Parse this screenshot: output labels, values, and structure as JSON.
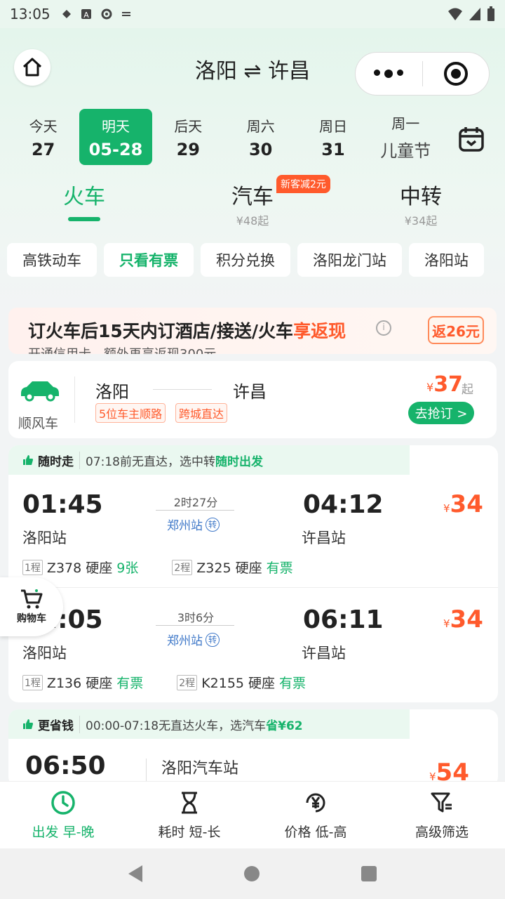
{
  "status_bar": {
    "time": "13:05"
  },
  "header": {
    "title": "洛阳 ⇌ 许昌"
  },
  "dates": [
    {
      "label": "今天",
      "value": "27"
    },
    {
      "label": "明天",
      "value": "05-28"
    },
    {
      "label": "后天",
      "value": "29"
    },
    {
      "label": "周六",
      "value": "30"
    },
    {
      "label": "周日",
      "value": "31"
    },
    {
      "label": "周一",
      "value": "儿童节"
    }
  ],
  "modes": {
    "train": {
      "label": "火车"
    },
    "bus": {
      "label": "汽车",
      "sub": "¥48起",
      "badge": "新客减2元"
    },
    "transfer": {
      "label": "中转",
      "sub": "¥34起"
    }
  },
  "filters": [
    "高铁动车",
    "只看有票",
    "积分兑换",
    "洛阳龙门站",
    "洛阳站"
  ],
  "promo": {
    "title_prefix": "订火车后15天内订酒店/接送/火车",
    "title_highlight": "享返现",
    "info": "i",
    "rebate": "返26元",
    "sub": "开通信用卡，额外再享返现300元"
  },
  "ride": {
    "label": "顺风车",
    "from": "洛阳",
    "to": "许昌",
    "tag1": "5位车主顺路",
    "tag2": "跨城直达",
    "currency": "¥",
    "price": "37",
    "price_suffix": "起",
    "button": "去抢订 >"
  },
  "section1": {
    "tag": "随时走",
    "text": "07:18前无直达，选中转",
    "highlight": "随时出发"
  },
  "trains": [
    {
      "dep_time": "01:45",
      "dep_station": "洛阳站",
      "duration": "2时27分",
      "via": "郑州站",
      "via_mark": "转",
      "arr_time": "04:12",
      "arr_station": "许昌站",
      "currency": "¥",
      "price": "34",
      "leg1_no": "1程",
      "leg1": "Z378 硬座",
      "leg1_avail": "9张",
      "leg2_no": "2程",
      "leg2": "Z325 硬座",
      "leg2_avail": "有票"
    },
    {
      "dep_time": "02:05",
      "dep_station": "洛阳站",
      "duration": "3时6分",
      "via": "郑州站",
      "via_mark": "转",
      "arr_time": "06:11",
      "arr_station": "许昌站",
      "currency": "¥",
      "price": "34",
      "leg1_no": "1程",
      "leg1": "Z136 硬座",
      "leg1_avail": "有票",
      "leg2_no": "2程",
      "leg2": "K2155 硬座",
      "leg2_avail": "有票"
    }
  ],
  "section2": {
    "tag": "更省钱",
    "text": "00:00-07:18无直达火车，选汽车",
    "highlight": "省¥62"
  },
  "bus_row": {
    "dep_time": "06:50",
    "station": "洛阳汽车站",
    "currency": "¥",
    "price": "54"
  },
  "cart": {
    "label": "购物车"
  },
  "bottom_bar": [
    {
      "label": "出发 早-晚",
      "icon": "clock-icon"
    },
    {
      "label": "耗时 短-长",
      "icon": "hourglass-icon"
    },
    {
      "label": "价格 低-高",
      "icon": "yuan-icon"
    },
    {
      "label": "高级筛选",
      "icon": "filter-icon"
    }
  ],
  "colors": {
    "accent": "#16b36b",
    "price": "#ff5a2c"
  }
}
